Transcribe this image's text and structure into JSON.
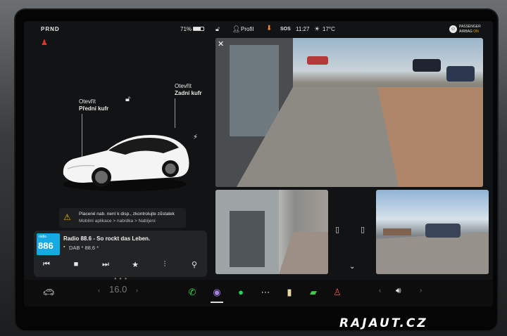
{
  "status": {
    "gear": "PRND",
    "battery": "71%",
    "battery_level": 0.71,
    "profile": "Profil",
    "sos": "SOS",
    "time": "11:27",
    "temperature": "17°C",
    "airbag_line1": "PASSENGER",
    "airbag_line2": "AIRBAG",
    "airbag_state": "ON"
  },
  "car": {
    "front_trunk_action": "Otevřít",
    "front_trunk_name": "Přední kufr",
    "rear_trunk_action": "Otevřít",
    "rear_trunk_name": "Zadní kufr"
  },
  "warning": {
    "line1": "Placené nab. není k disp., zkontrolujte zůstatek",
    "line2": "Mobilní aplikace > nabídka > Nabíjení"
  },
  "media": {
    "logo_small": "rádio",
    "logo_big": "886",
    "title": "Radio 88.6 - So rockt das Leben.",
    "subtitle": "DAB * 88.6 *"
  },
  "dock": {
    "temp": "16.0"
  },
  "watermark": "RAJAUT.CZ",
  "colors": {
    "accent_orange": "#ff8a2a",
    "warning_yellow": "#f5b400",
    "seatbelt_red": "#e0362a",
    "phone_green": "#3ad04a",
    "spotify_green": "#1ed760"
  }
}
